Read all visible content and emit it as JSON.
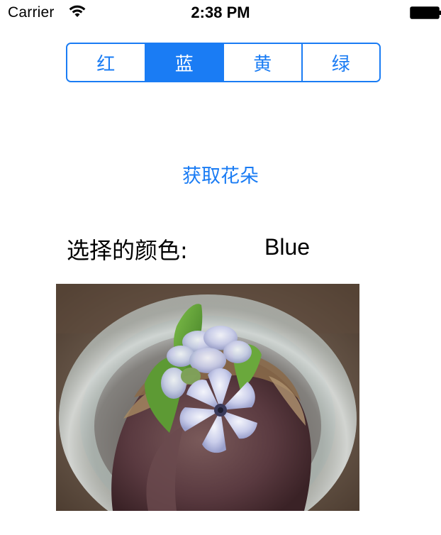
{
  "status_bar": {
    "carrier": "Carrier",
    "time": "2:38 PM",
    "wifi_icon": "wifi-icon",
    "battery_icon": "battery-icon"
  },
  "segmented_control": {
    "segments": [
      {
        "label": "红",
        "selected": false
      },
      {
        "label": "蓝",
        "selected": true
      },
      {
        "label": "黄",
        "selected": false
      },
      {
        "label": "绿",
        "selected": false
      }
    ],
    "accent_color": "#1a7cf4"
  },
  "fetch_button": {
    "label": "获取花朵"
  },
  "selected_color": {
    "label": "选择的颜色:",
    "value": "Blue"
  },
  "flower_image": {
    "subject": "blue hyacinth flower in glass jar"
  }
}
